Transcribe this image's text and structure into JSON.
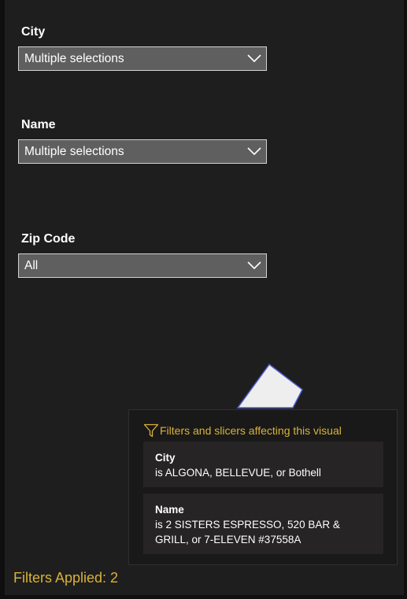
{
  "slicers": [
    {
      "title": "City",
      "value": "Multiple selections"
    },
    {
      "title": "Name",
      "value": "Multiple selections"
    },
    {
      "title": "Zip Code",
      "value": "All"
    }
  ],
  "tooltip": {
    "header": "Filters and slicers affecting this visual",
    "cards": [
      {
        "title": "City",
        "description": "is ALGONA, BELLEVUE, or Bothell"
      },
      {
        "title": "Name",
        "description": "is 2 SISTERS ESPRESSO, 520 BAR & GRILL, or 7-ELEVEN #37558A"
      }
    ]
  },
  "footer": {
    "filters_applied": "Filters Applied: 2"
  },
  "icons": {
    "chevron": "chevron-down-icon",
    "funnel": "filter-icon"
  },
  "colors": {
    "accent": "#d9b23a",
    "panel_background": "#1e1e1e",
    "dropdown_background": "#5f5f5f"
  }
}
